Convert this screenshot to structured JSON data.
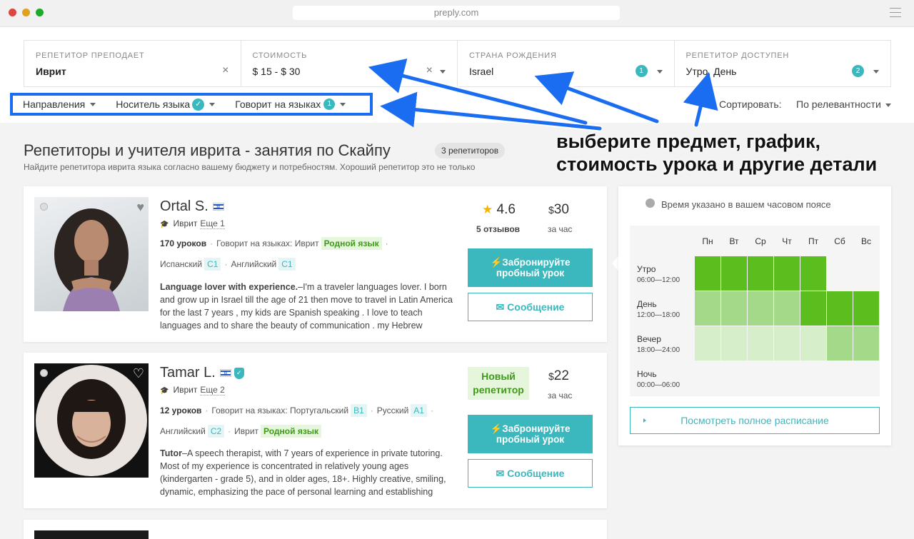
{
  "browser": {
    "url": "preply.com"
  },
  "filters": [
    {
      "label": "РЕПЕТИТОР ПРЕПОДАЕТ",
      "value": "Иврит"
    },
    {
      "label": "СТОИМОСТЬ",
      "value": "$ 15 - $ 30"
    },
    {
      "label": "СТРАНА РОЖДЕНИЯ",
      "value": "Israel",
      "badge": "1"
    },
    {
      "label": "РЕПЕТИТОР ДОСТУПЕН",
      "value": "Утро, День",
      "badge": "2"
    }
  ],
  "subfilters": {
    "directions": "Направления",
    "native": "Носитель языка",
    "native_check": "✓",
    "speaks": "Говорит на языках",
    "speaks_badge": "1"
  },
  "sort": {
    "label": "Сортировать:",
    "value": "По релевантности"
  },
  "page": {
    "title": "Репетиторы и учителя иврита - занятия по Скайпу",
    "count": "3 репетиторов",
    "subtitle": "Найдите репетитора иврита языка согласно вашему бюджету и потребностям. Хороший репетитор это не только"
  },
  "annotation": {
    "line1": "выберите предмет, график,",
    "line2": "стоимость урока и другие детали"
  },
  "tutors": [
    {
      "name": "Ortal S.",
      "subject": "Иврит",
      "more": "Еще 1",
      "lessons": "170 уроков",
      "speaks_label": "Говорит на языках: Иврит",
      "native_tag": "Родной язык",
      "lang1": "Испанский",
      "lang1_level": "C1",
      "lang2": "Английский",
      "lang2_level": "C1",
      "desc_bold": "Language lover with experience.",
      "desc": "–I'm a traveler languages lover. I born and grow up in Israel till the age of 21 then move to travel in Latin America for the last 7 years , my kids are Spanish speaking . I love to teach languages and to share the beauty of communication . my Hebrew",
      "rating": "4.6",
      "reviews": "5 отзывов",
      "price": "30",
      "currency": "$",
      "per_hour": "за час",
      "book_line1": "⚡Забронируйте",
      "book_line2": "пробный урок",
      "message": "Сообщение"
    },
    {
      "name": "Tamar L.",
      "subject": "Иврит",
      "more": "Еще 2",
      "lessons": "12 уроков",
      "speaks_label": "Говорит на языках: Португальский",
      "lang_a_level": "B1",
      "lang_b": "Русский",
      "lang_b_level": "A1",
      "lang1": "Английский",
      "lang1_level": "C2",
      "lang2": "Иврит",
      "native_tag": "Родной язык",
      "desc_bold": "Tutor",
      "desc": "–A speech therapist, with 7 years of experience in private tutoring. Most of my experience is concentrated in relatively young ages (kindergarten - grade 5), and in older ages, 18+. Highly creative, smiling, dynamic, emphasizing the pace of personal learning and establishing",
      "new_line1": "Новый",
      "new_line2": "репетитор",
      "price": "22",
      "currency": "$",
      "per_hour": "за час",
      "book_line1": "⚡Забронируйте",
      "book_line2": "пробный урок",
      "message": "Сообщение"
    }
  ],
  "schedule": {
    "header": "Время указано в вашем часовом поясе",
    "days": [
      "Пн",
      "Вт",
      "Ср",
      "Чт",
      "Пт",
      "Сб",
      "Вс"
    ],
    "rows": [
      {
        "label": "Утро",
        "time": "06:00—12:00",
        "levels": [
          3,
          3,
          3,
          3,
          3,
          0,
          0
        ]
      },
      {
        "label": "День",
        "time": "12:00—18:00",
        "levels": [
          2,
          2,
          2,
          2,
          3,
          3,
          3
        ]
      },
      {
        "label": "Вечер",
        "time": "18:00—24:00",
        "levels": [
          1,
          1,
          1,
          1,
          1,
          2,
          2
        ]
      },
      {
        "label": "Ночь",
        "time": "00:00—06:00",
        "levels": [
          0,
          0,
          0,
          0,
          0,
          0,
          0
        ]
      }
    ],
    "full_button": "Посмотреть полное расписание"
  },
  "colors": {
    "accent": "#3ab8bd",
    "highlight_box": "#1a6df0",
    "avail_high": "#5bbd1e",
    "avail_mid": "#a4d98a",
    "avail_low": "#d6eec9"
  }
}
